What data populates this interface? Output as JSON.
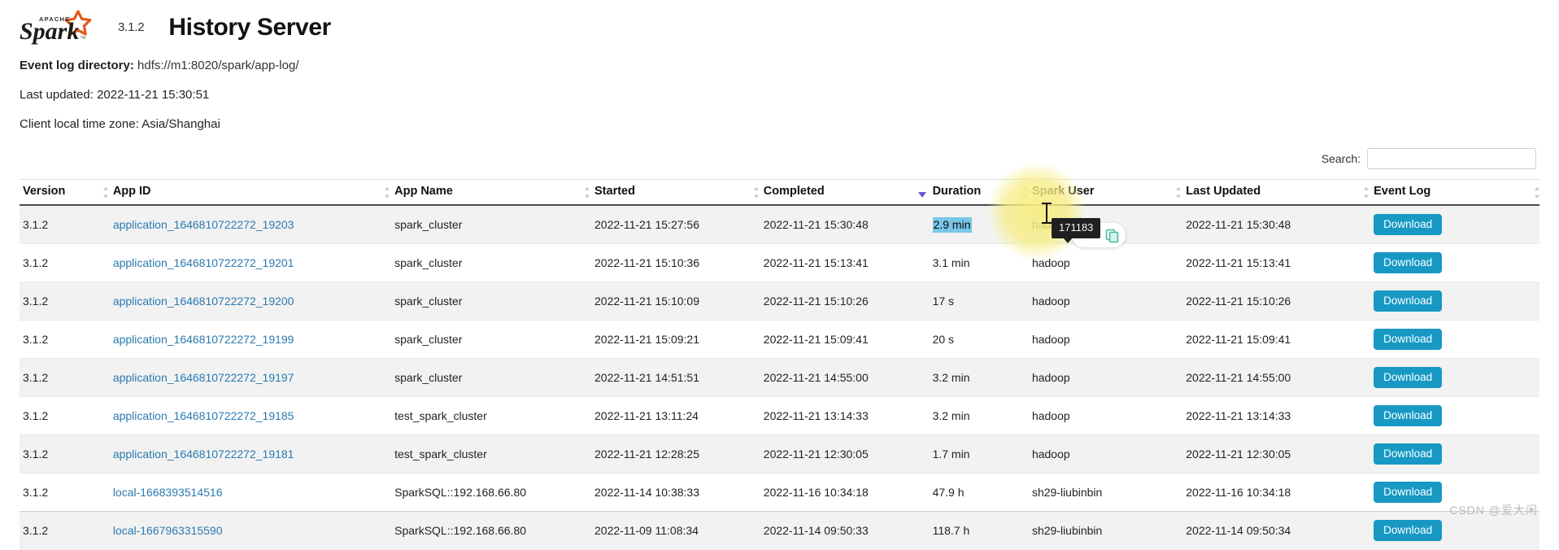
{
  "header": {
    "logo_text": "Spark",
    "logo_superscript": "APACHE",
    "version": "3.1.2",
    "title": "History Server"
  },
  "meta": {
    "event_log_directory_label": "Event log directory:",
    "event_log_directory_value": "hdfs://m1:8020/spark/app-log/",
    "last_updated_line": "Last updated: 2022-11-21 15:30:51",
    "client_time_zone_line": "Client local time zone: Asia/Shanghai"
  },
  "search": {
    "label": "Search:",
    "value": "",
    "placeholder": ""
  },
  "table": {
    "columns": [
      "Version",
      "App ID",
      "App Name",
      "Started",
      "Completed",
      "Duration",
      "Spark User",
      "Last Updated",
      "Event Log"
    ],
    "sorted_column": "Duration",
    "sort_direction": "desc",
    "download_label": "Download",
    "rows": [
      {
        "version": "3.1.2",
        "app_id": "application_1646810722272_19203",
        "app_name": "spark_cluster",
        "started": "2022-11-21 15:27:56",
        "completed": "2022-11-21 15:30:48",
        "duration": "2.9 min",
        "spark_user": "hadoop",
        "last_updated": "2022-11-21 15:30:48",
        "event_log": "Download",
        "duration_selected": true
      },
      {
        "version": "3.1.2",
        "app_id": "application_1646810722272_19201",
        "app_name": "spark_cluster",
        "started": "2022-11-21 15:10:36",
        "completed": "2022-11-21 15:13:41",
        "duration": "3.1 min",
        "spark_user": "hadoop",
        "last_updated": "2022-11-21 15:13:41",
        "event_log": "Download",
        "duration_selected": false
      },
      {
        "version": "3.1.2",
        "app_id": "application_1646810722272_19200",
        "app_name": "spark_cluster",
        "started": "2022-11-21 15:10:09",
        "completed": "2022-11-21 15:10:26",
        "duration": "17 s",
        "spark_user": "hadoop",
        "last_updated": "2022-11-21 15:10:26",
        "event_log": "Download",
        "duration_selected": false
      },
      {
        "version": "3.1.2",
        "app_id": "application_1646810722272_19199",
        "app_name": "spark_cluster",
        "started": "2022-11-21 15:09:21",
        "completed": "2022-11-21 15:09:41",
        "duration": "20 s",
        "spark_user": "hadoop",
        "last_updated": "2022-11-21 15:09:41",
        "event_log": "Download",
        "duration_selected": false
      },
      {
        "version": "3.1.2",
        "app_id": "application_1646810722272_19197",
        "app_name": "spark_cluster",
        "started": "2022-11-21 14:51:51",
        "completed": "2022-11-21 14:55:00",
        "duration": "3.2 min",
        "spark_user": "hadoop",
        "last_updated": "2022-11-21 14:55:00",
        "event_log": "Download",
        "duration_selected": false
      },
      {
        "version": "3.1.2",
        "app_id": "application_1646810722272_19185",
        "app_name": "test_spark_cluster",
        "started": "2022-11-21 13:11:24",
        "completed": "2022-11-21 13:14:33",
        "duration": "3.2 min",
        "spark_user": "hadoop",
        "last_updated": "2022-11-21 13:14:33",
        "event_log": "Download",
        "duration_selected": false
      },
      {
        "version": "3.1.2",
        "app_id": "application_1646810722272_19181",
        "app_name": "test_spark_cluster",
        "started": "2022-11-21 12:28:25",
        "completed": "2022-11-21 12:30:05",
        "duration": "1.7 min",
        "spark_user": "hadoop",
        "last_updated": "2022-11-21 12:30:05",
        "event_log": "Download",
        "duration_selected": false
      },
      {
        "version": "3.1.2",
        "app_id": "local-1668393514516",
        "app_name": "SparkSQL::192.168.66.80",
        "started": "2022-11-14 10:38:33",
        "completed": "2022-11-16 10:34:18",
        "duration": "47.9 h",
        "spark_user": "sh29-liubinbin",
        "last_updated": "2022-11-16 10:34:18",
        "event_log": "Download",
        "duration_selected": false
      },
      {
        "version": "3.1.2",
        "app_id": "local-1667963315590",
        "app_name": "SparkSQL::192.168.66.80",
        "started": "2022-11-09 11:08:34",
        "completed": "2022-11-14 09:50:33",
        "duration": "118.7 h",
        "spark_user": "sh29-liubinbin",
        "last_updated": "2022-11-14 09:50:34",
        "event_log": "Download",
        "duration_selected": false
      }
    ]
  },
  "overlay": {
    "tooltip_text": "171183",
    "copy_icon_name": "copy-icon"
  },
  "watermark": {
    "text": "CSDN @爱大闲"
  },
  "colors": {
    "link": "#2a7ab0",
    "download_button": "#1799c4",
    "selection": "#79c7e8",
    "highlight_glow": "#f7ed82",
    "tooltip_bg": "#1f1f1f",
    "sort_active": "#6a5acd"
  }
}
